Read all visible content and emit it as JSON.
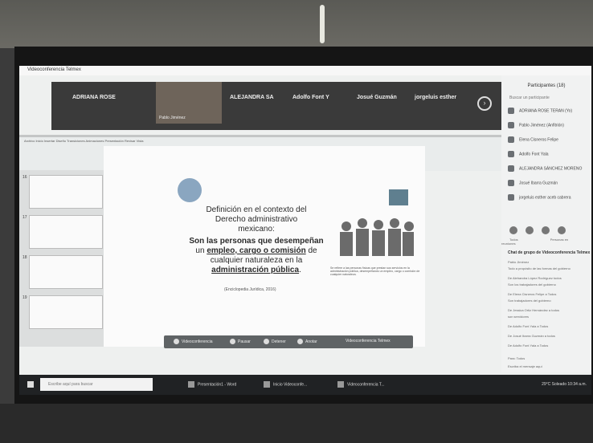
{
  "window": {
    "title": "Videoconferencia Telmex"
  },
  "video": {
    "participants": [
      {
        "name": "ADRIANA ROSE"
      },
      {
        "name": "ALEJANDRA SA"
      },
      {
        "name": "Adolfo Font Y"
      },
      {
        "name": "Josué Guzmán"
      },
      {
        "name": "jorgeluis esther"
      }
    ],
    "thumb_caption": "Pablo Jiménez",
    "next_label": "›"
  },
  "ribbon": {
    "tabs_label": "Archivo  Inicio  Insertar  Diseño  Transiciones  Animaciones  Presentación  Revisar  Vista"
  },
  "slide": {
    "title_lines": [
      "Definición en el contexto del",
      "Derecho administrativo",
      "mexicano:"
    ],
    "body_bold": "Son las personas que desempeñan",
    "body_pre": "un ",
    "body_u": "empleo, cargo o comisión",
    "body_mid": " de cualquier naturaleza en la ",
    "body_u2": "administración pública",
    "body_end": ".",
    "citation": "(Enciclopedia Jurídica, 2016)",
    "paragraph": "Se refiere a las personas físicas que prestan sus servicios en la administración pública, desempeñando un empleo, cargo o comisión de cualquier naturaleza."
  },
  "thumbnails": [
    {
      "n": "16"
    },
    {
      "n": "17"
    },
    {
      "n": "18"
    },
    {
      "n": "19"
    }
  ],
  "sharebar": {
    "items": [
      "Videoconferencia",
      "Pausar",
      "Detener",
      "Anotar"
    ],
    "right_label": "Videoconferencia Telmex"
  },
  "sidebar": {
    "header": "Participantes (18)",
    "search_placeholder": "Buscar un participante",
    "participants": [
      "ADRIANA ROSE TERAN (Yo)",
      "Pablo Jiménez (Anfitrión)",
      "Elena Cisneros Felipe",
      "Adolfo Font Yala",
      "ALEJANDRA SÁNCHEZ MORENO",
      "Josué Ibarra Guzmán",
      "jorgeluis esther aceb cabrera"
    ],
    "tab_left": "Todos",
    "tab_right": "Personas en reuniones",
    "chat_header": "Chat de grupo de Videoconferencia Telmex",
    "chat_messages": [
      "Pablo Jiménez",
      "Todo a propósito de las formas del gobierno",
      "De Alehandra López Rodríguez todos",
      "Son los trabajadores del gobierno",
      "De Elena Cisneros Felipe a Todos",
      "Son trabajadores del gobierno",
      "De Jessica Ortiz Hernández a todos",
      "son servidores",
      "De Adolfo Font Yala a Todos",
      "De Josué Ibarra Guzmán a todos",
      "De Adolfo Font Yala a Todos"
    ],
    "input_placeholder": "Para: Todos",
    "send_placeholder": "Escriba el mensaje aquí"
  },
  "taskbar": {
    "search_placeholder": "Escribe aquí para buscar",
    "items": [
      "Presentación1 - Word",
      "Inicio Videoconfe...",
      "Videoconferencia T..."
    ],
    "tray": "29°C  Soleado  10:34 a.m."
  }
}
